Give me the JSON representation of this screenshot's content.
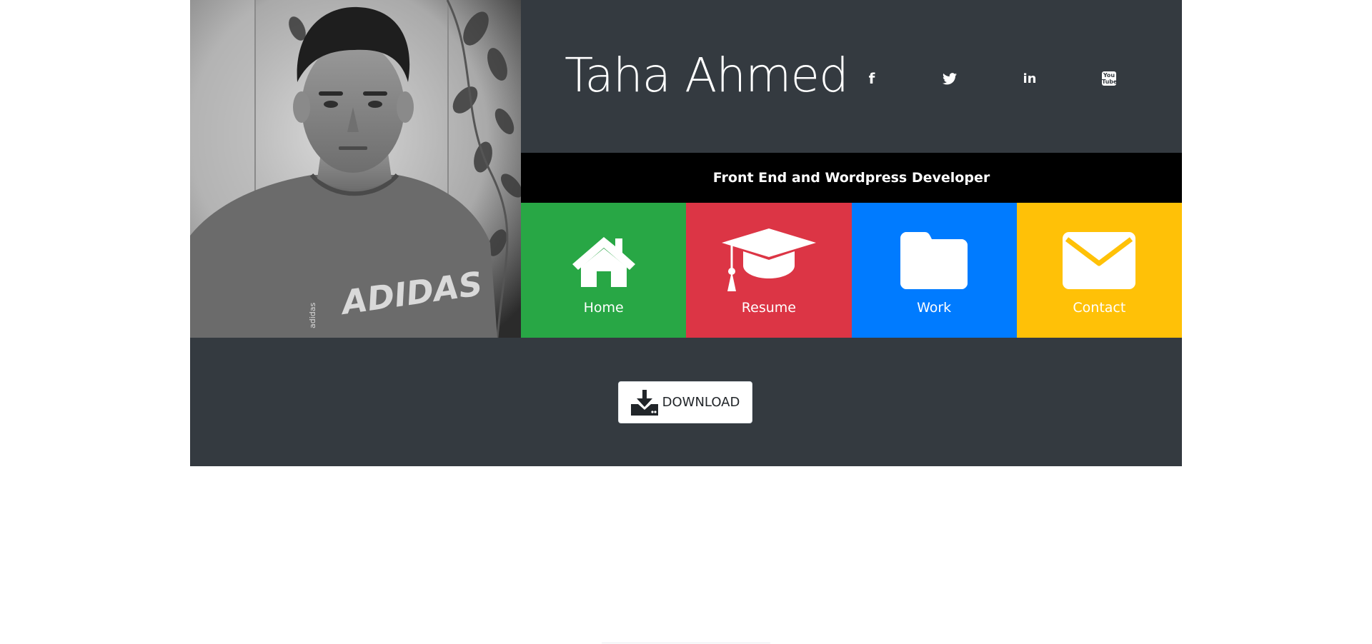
{
  "profile": {
    "name": "Taha Ahmed",
    "tagline": "Front End and Wordpress Developer",
    "photo_shirt_text": "ADIDAS",
    "photo_shirt_small": "adidas"
  },
  "social": [
    {
      "icon": "facebook-icon",
      "glyph": "f"
    },
    {
      "icon": "twitter-icon"
    },
    {
      "icon": "linkedin-icon",
      "glyph": "in"
    },
    {
      "icon": "youtube-icon",
      "glyph": "You Tube"
    }
  ],
  "nav": {
    "tiles": [
      {
        "label": "Home",
        "icon": "home-icon",
        "color": "#28a745"
      },
      {
        "label": "Resume",
        "icon": "graduation-cap-icon",
        "color": "#dc3545"
      },
      {
        "label": "Work",
        "icon": "folder-icon",
        "color": "#007bff"
      },
      {
        "label": "Contact",
        "icon": "envelope-icon",
        "color": "#ffc107"
      }
    ]
  },
  "download": {
    "label": "DOWNLOAD",
    "icon": "download-icon"
  },
  "colors": {
    "card_bg": "#343a40",
    "tagline_bg": "#000000",
    "page_bg": "#ffffff"
  }
}
